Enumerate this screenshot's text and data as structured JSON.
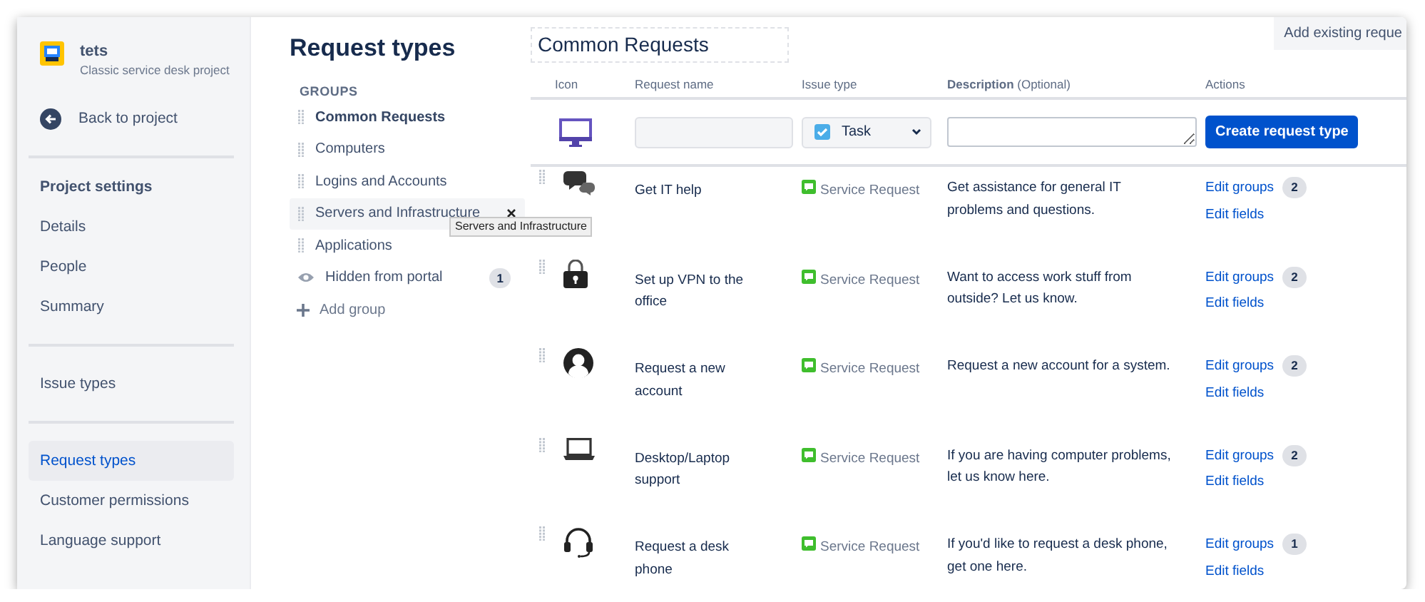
{
  "sidebar": {
    "project": {
      "name": "tets",
      "subtitle": "Classic service desk project"
    },
    "back_link": "Back to project",
    "sections": [
      {
        "heading": "Project settings",
        "items": [
          {
            "label": "Details",
            "selected": false
          },
          {
            "label": "People",
            "selected": false
          },
          {
            "label": "Summary",
            "selected": false
          }
        ]
      },
      {
        "items": [
          {
            "label": "Issue types",
            "selected": false
          }
        ]
      },
      {
        "items": [
          {
            "label": "Request types",
            "selected": true
          },
          {
            "label": "Customer permissions",
            "selected": false
          },
          {
            "label": "Language support",
            "selected": false
          }
        ]
      }
    ]
  },
  "groups": {
    "title": "Request types",
    "heading": "GROUPS",
    "items": [
      {
        "kind": "group",
        "label": "Common Requests",
        "selected": true,
        "hovered": false
      },
      {
        "kind": "group",
        "label": "Computers",
        "selected": false,
        "hovered": false
      },
      {
        "kind": "group",
        "label": "Logins and Accounts",
        "selected": false,
        "hovered": false
      },
      {
        "kind": "group",
        "label": "Servers and Infrastructure",
        "selected": false,
        "hovered": true,
        "tooltip": "Servers and Infrastructure"
      },
      {
        "kind": "group",
        "label": "Applications",
        "selected": false,
        "hovered": false
      },
      {
        "kind": "hidden",
        "label": "Hidden from portal",
        "selected": false,
        "hovered": false,
        "count": "1"
      }
    ],
    "add_group": "Add group"
  },
  "main": {
    "title": "Common Requests",
    "add_existing_button": "Add existing reque",
    "columns": [
      {
        "label": "Icon"
      },
      {
        "label": "Request name"
      },
      {
        "label": "Issue type"
      },
      {
        "label": "**Description** (Optional)"
      },
      {
        "label": "Actions"
      }
    ],
    "create_row": {
      "issue_type": "Task",
      "button": "Create request type"
    },
    "rows": [
      {
        "kind": "chat",
        "name": "Get IT help",
        "issue_type": "Service Request",
        "description": "Get assistance for general IT problems and questions.",
        "edit_groups": "Edit groups",
        "group_count": "2",
        "edit_fields": "Edit fields"
      },
      {
        "kind": "lock",
        "name": "Set up VPN to the office",
        "issue_type": "Service Request",
        "description": "Want to access work stuff from outside? Let us know.",
        "edit_groups": "Edit groups",
        "group_count": "2",
        "edit_fields": "Edit fields"
      },
      {
        "kind": "person",
        "name": "Request a new account",
        "issue_type": "Service Request",
        "description": "Request a new account for a system.",
        "edit_groups": "Edit groups",
        "group_count": "2",
        "edit_fields": "Edit fields"
      },
      {
        "kind": "laptop",
        "name": "Desktop/Laptop support",
        "issue_type": "Service Request",
        "description": "If you are having computer problems, let us know here.",
        "edit_groups": "Edit groups",
        "group_count": "2",
        "edit_fields": "Edit fields"
      },
      {
        "kind": "headset",
        "name": "Request a desk phone",
        "issue_type": "Service Request",
        "description": "If you'd like to request a desk phone, get one here.",
        "edit_groups": "Edit groups",
        "group_count": "1",
        "edit_fields": "Edit fields"
      }
    ]
  }
}
